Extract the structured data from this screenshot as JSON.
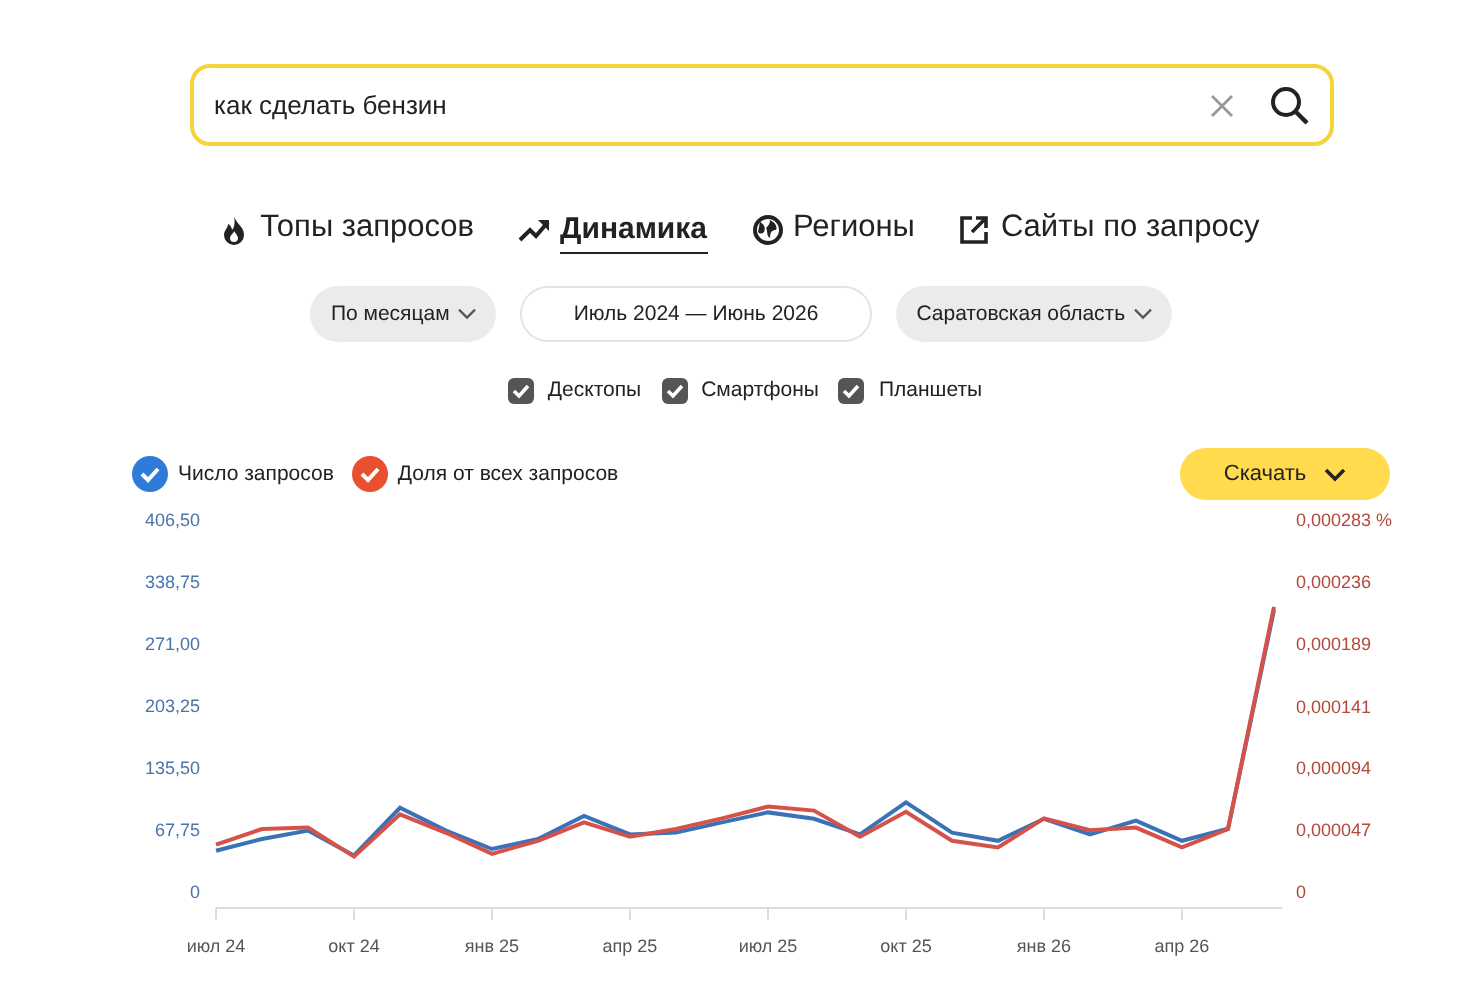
{
  "search": {
    "value": "как сделать бензин"
  },
  "tabs": [
    {
      "label": "Топы запросов",
      "kind": "fire",
      "selected": false
    },
    {
      "label": "Динамика",
      "kind": "trend",
      "selected": true
    },
    {
      "label": "Регионы",
      "kind": "globe",
      "selected": false
    },
    {
      "label": "Сайты по запросу",
      "kind": "external",
      "selected": false
    }
  ],
  "filters": [
    {
      "label": "По месяцам",
      "kind": "dropdown"
    },
    {
      "label": "Июль 2024 — Июнь 2026",
      "kind": "range"
    },
    {
      "label": "Саратовская область",
      "kind": "dropdown"
    }
  ],
  "devices": [
    {
      "label": "Десктопы",
      "checked": true
    },
    {
      "label": "Смартфоны",
      "checked": true
    },
    {
      "label": "Планшеты",
      "checked": true
    }
  ],
  "legend": [
    {
      "checked": true,
      "color": "#2f7bd9"
    },
    {
      "checked": true,
      "color": "#e8502f"
    }
  ],
  "download_button": {
    "label": "Скачать"
  },
  "chart_data": {
    "type": "line",
    "x": [
      "июл 24",
      null,
      null,
      "окт 24",
      null,
      null,
      "янв 25",
      null,
      null,
      "апр 25",
      null,
      null,
      "июл 25",
      null,
      null,
      "окт 25",
      null,
      null,
      "янв 26",
      null,
      null,
      "апр 26",
      null,
      null
    ],
    "ylim": [
      0,
      406.5
    ],
    "y2lim": [
      0,
      0.000283
    ],
    "y2ticks": [
      {
        "value": 0,
        "label": "0"
      },
      {
        "value": 4.7e-05,
        "label": "0,000047"
      },
      {
        "value": 9.4e-05,
        "label": "0,000094"
      },
      {
        "value": 0.000141,
        "label": "0,000141"
      },
      {
        "value": 0.000189,
        "label": "0,000189"
      },
      {
        "value": 0.000236,
        "label": "0,000236"
      },
      {
        "value": 0.000283,
        "label": "0,000283 %"
      }
    ],
    "yticks": [
      {
        "value": 0,
        "label": "0"
      },
      {
        "value": 67.75,
        "label": "67,75"
      },
      {
        "value": 135.5,
        "label": "135,50"
      },
      {
        "value": 203.25,
        "label": "203,25"
      },
      {
        "value": 271,
        "label": "271,00"
      },
      {
        "value": 338.75,
        "label": "338,75"
      },
      {
        "value": 406.5,
        "label": "406,50"
      }
    ],
    "series": [
      {
        "name": "Число запросов",
        "color": "#3a72b8",
        "values": [
          45,
          58,
          67,
          40,
          92,
          67,
          47,
          58,
          83,
          63,
          65,
          76,
          87,
          80,
          63,
          98,
          65,
          56,
          80,
          63,
          78,
          56,
          69,
          308
        ]
      },
      {
        "name": "Доля от всех запросов",
        "color": "#d5524a",
        "axis": "y2",
        "values": [
          3.6e-05,
          4.8e-05,
          4.9e-05,
          2.7e-05,
          5.9e-05,
          4.5e-05,
          2.9e-05,
          3.9e-05,
          5.3e-05,
          4.2e-05,
          4.8e-05,
          5.6e-05,
          6.5e-05,
          6.2e-05,
          4.2e-05,
          6.1e-05,
          3.9e-05,
          3.4e-05,
          5.6e-05,
          4.7e-05,
          4.9e-05,
          3.4e-05,
          4.8e-05,
          0.000217
        ]
      }
    ]
  }
}
